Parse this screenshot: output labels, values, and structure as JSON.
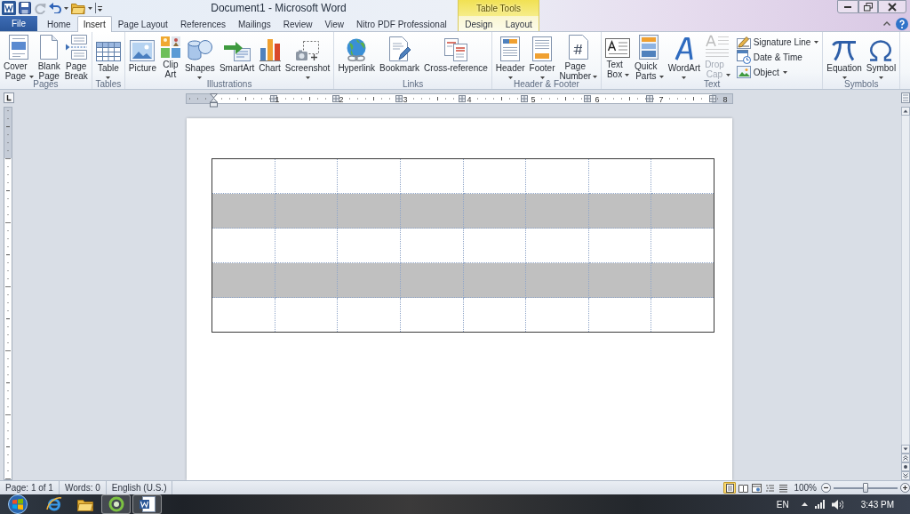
{
  "title_bar": {
    "title": "Document1 - Microsoft Word"
  },
  "tabs": [
    {
      "label": "File",
      "kind": "file",
      "selected": false
    },
    {
      "label": "Home",
      "kind": "tab",
      "selected": false
    },
    {
      "label": "Insert",
      "kind": "tab",
      "selected": true
    },
    {
      "label": "Page Layout",
      "kind": "tab",
      "selected": false
    },
    {
      "label": "References",
      "kind": "tab",
      "selected": false
    },
    {
      "label": "Mailings",
      "kind": "tab",
      "selected": false
    },
    {
      "label": "Review",
      "kind": "tab",
      "selected": false
    },
    {
      "label": "View",
      "kind": "tab",
      "selected": false
    },
    {
      "label": "Nitro PDF Professional",
      "kind": "tab",
      "selected": false
    }
  ],
  "contextual_tabs": {
    "title": "Table Tools",
    "tabs": [
      {
        "label": "Design",
        "selected": false
      },
      {
        "label": "Layout",
        "selected": false
      }
    ]
  },
  "ribbon": {
    "groups": [
      {
        "label": "Pages",
        "buttons": [
          {
            "label": "Cover Page",
            "kind": "large",
            "dropdown": true,
            "disabled": false
          },
          {
            "label": "Blank Page",
            "kind": "large",
            "dropdown": false,
            "disabled": false
          },
          {
            "label": "Page Break",
            "kind": "large",
            "dropdown": false,
            "disabled": false
          }
        ]
      },
      {
        "label": "Tables",
        "buttons": [
          {
            "label": "Table",
            "kind": "large",
            "dropdown": true,
            "disabled": false
          }
        ]
      },
      {
        "label": "Illustrations",
        "buttons": [
          {
            "label": "Picture",
            "kind": "large",
            "dropdown": false,
            "disabled": false
          },
          {
            "label": "Clip Art",
            "kind": "large",
            "dropdown": false,
            "disabled": false
          },
          {
            "label": "Shapes",
            "kind": "large",
            "dropdown": true,
            "disabled": false
          },
          {
            "label": "SmartArt",
            "kind": "large",
            "dropdown": false,
            "disabled": false
          },
          {
            "label": "Chart",
            "kind": "large",
            "dropdown": false,
            "disabled": false
          },
          {
            "label": "Screenshot",
            "kind": "large",
            "dropdown": true,
            "disabled": false
          }
        ]
      },
      {
        "label": "Links",
        "buttons": [
          {
            "label": "Hyperlink",
            "kind": "large",
            "dropdown": false,
            "disabled": false
          },
          {
            "label": "Bookmark",
            "kind": "large",
            "dropdown": false,
            "disabled": false
          },
          {
            "label": "Cross-reference",
            "kind": "large",
            "dropdown": false,
            "disabled": false
          }
        ]
      },
      {
        "label": "Header & Footer",
        "buttons": [
          {
            "label": "Header",
            "kind": "large",
            "dropdown": true,
            "disabled": false
          },
          {
            "label": "Footer",
            "kind": "large",
            "dropdown": true,
            "disabled": false
          },
          {
            "label": "Page Number",
            "kind": "large",
            "dropdown": true,
            "disabled": false
          }
        ]
      },
      {
        "label": "Text",
        "buttons": [
          {
            "label": "Text Box",
            "kind": "large",
            "dropdown": true,
            "disabled": false
          },
          {
            "label": "Quick Parts",
            "kind": "large",
            "dropdown": true,
            "disabled": false
          },
          {
            "label": "WordArt",
            "kind": "large",
            "dropdown": true,
            "disabled": false
          },
          {
            "label": "Drop Cap",
            "kind": "large",
            "dropdown": true,
            "disabled": true
          },
          {
            "label": "Signature Line",
            "kind": "small",
            "dropdown": true,
            "disabled": false
          },
          {
            "label": "Date & Time",
            "kind": "small",
            "dropdown": false,
            "disabled": false
          },
          {
            "label": "Object",
            "kind": "small",
            "dropdown": true,
            "disabled": false
          }
        ]
      },
      {
        "label": "Symbols",
        "buttons": [
          {
            "label": "Equation",
            "kind": "large",
            "dropdown": true,
            "disabled": false
          },
          {
            "label": "Symbol",
            "kind": "large",
            "dropdown": true,
            "disabled": false
          }
        ]
      }
    ]
  },
  "ruler": {
    "numbers": [
      "1",
      "2",
      "3",
      "4",
      "5",
      "6",
      "7",
      "8"
    ]
  },
  "table": {
    "rows": [
      {
        "cells": [
          {
            "shaded": false
          },
          {
            "shaded": false
          },
          {
            "shaded": false
          },
          {
            "shaded": false
          },
          {
            "shaded": false
          },
          {
            "shaded": false
          },
          {
            "shaded": false
          },
          {
            "shaded": false
          }
        ]
      },
      {
        "cells": [
          {
            "shaded": true
          },
          {
            "shaded": true
          },
          {
            "shaded": true
          },
          {
            "shaded": true
          },
          {
            "shaded": true
          },
          {
            "shaded": true
          },
          {
            "shaded": true
          },
          {
            "shaded": true
          }
        ]
      },
      {
        "cells": [
          {
            "shaded": false
          },
          {
            "shaded": false
          },
          {
            "shaded": false
          },
          {
            "shaded": false
          },
          {
            "shaded": false
          },
          {
            "shaded": false
          },
          {
            "shaded": false
          },
          {
            "shaded": false
          }
        ]
      },
      {
        "cells": [
          {
            "shaded": true
          },
          {
            "shaded": true
          },
          {
            "shaded": true
          },
          {
            "shaded": true
          },
          {
            "shaded": true
          },
          {
            "shaded": true
          },
          {
            "shaded": true
          },
          {
            "shaded": true
          }
        ]
      },
      {
        "cells": [
          {
            "shaded": false
          },
          {
            "shaded": false
          },
          {
            "shaded": false
          },
          {
            "shaded": false
          },
          {
            "shaded": false
          },
          {
            "shaded": false
          },
          {
            "shaded": false
          },
          {
            "shaded": false
          }
        ]
      }
    ]
  },
  "status_bar": {
    "items": [
      "Page: 1 of 1",
      "Words: 0",
      "English (U.S.)"
    ],
    "views": [
      {
        "selected": true
      },
      {
        "selected": false
      },
      {
        "selected": false
      },
      {
        "selected": false
      },
      {
        "selected": false
      }
    ],
    "zoom": {
      "label": "100%",
      "level": 0.5
    }
  },
  "taskbar": {
    "apps": [
      {
        "running": false
      },
      {
        "running": false
      },
      {
        "running": true
      },
      {
        "running": true
      }
    ],
    "language": "EN",
    "clock": "3:43 PM"
  }
}
